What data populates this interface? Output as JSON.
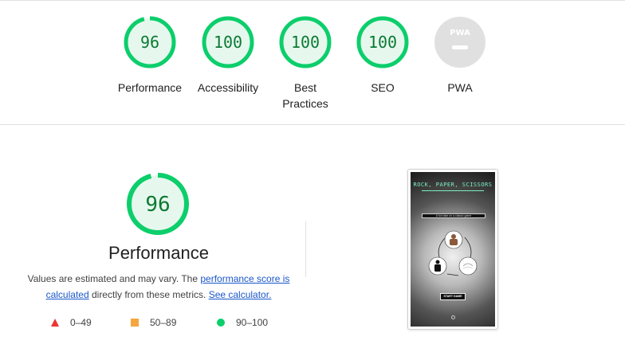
{
  "summary": {
    "gauges": [
      {
        "label": "Performance",
        "score": "96",
        "value": 96,
        "status": "pass"
      },
      {
        "label": "Accessibility",
        "score": "100",
        "value": 100,
        "status": "pass"
      },
      {
        "label": "Best Practices",
        "label_line1": "Best",
        "label_line2": "Practices",
        "score": "100",
        "value": 100,
        "status": "pass"
      },
      {
        "label": "SEO",
        "score": "100",
        "value": 100,
        "status": "pass"
      },
      {
        "label": "PWA",
        "score": "",
        "badge": "PWA",
        "status": "na"
      }
    ]
  },
  "performance": {
    "score": "96",
    "value": 96,
    "title": "Performance",
    "desc_prefix": "Values are estimated and may vary. The ",
    "desc_link1": "performance score is calculated",
    "desc_middle": " directly from these metrics. ",
    "desc_link2": "See calculator.",
    "legend": [
      {
        "icon": "triangle-icon",
        "range": "0–49",
        "color": "#ee3333"
      },
      {
        "icon": "square-icon",
        "range": "50–89",
        "color": "#f4a640"
      },
      {
        "icon": "circle-icon",
        "range": "90–100",
        "color": "#0cce6b"
      }
    ]
  },
  "screenshot": {
    "title": "ROCK, PAPER, SCISSORS",
    "subtitle": "A fun take on a classic game",
    "button": "START GAME"
  },
  "colors": {
    "pass": "#0cce6b",
    "pass_text": "#0c7a32",
    "pass_bg": "#e6f8ee",
    "na": "#e0e0e0",
    "link": "#1a57c8"
  }
}
